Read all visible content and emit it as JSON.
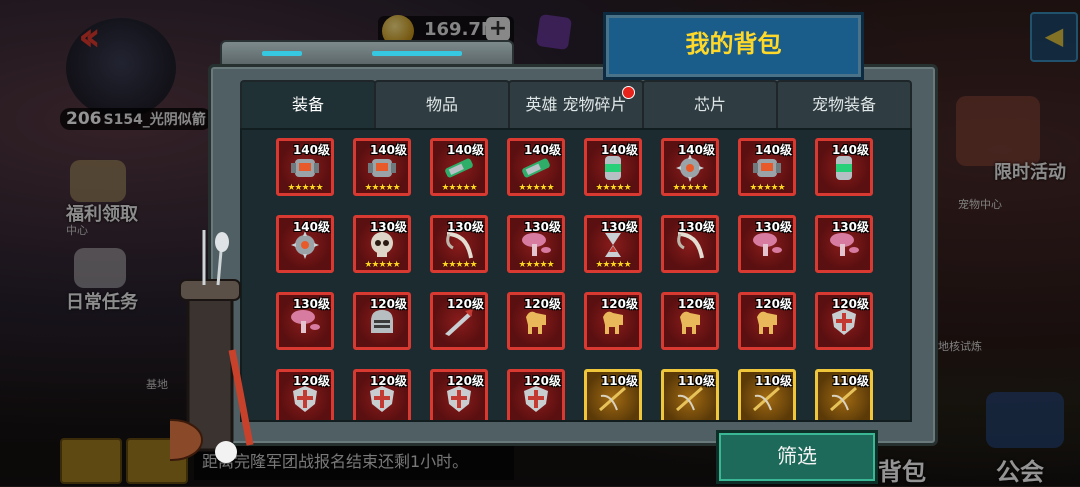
{
  "top_bar": {
    "player_level": "206",
    "player_name": "S154_光阴似箭",
    "currency": "169.7M",
    "currency_add": "+"
  },
  "side_left": {
    "welfare": "福利领取",
    "center": "中心",
    "daily": "日常任务",
    "base": "基地"
  },
  "side_right": {
    "limited_event": "限时活动",
    "pet_center": "宠物中心",
    "core_trial": "地核试炼"
  },
  "bottom": {
    "chat_text": "距离完隆军团战报名结束还剩1小时。",
    "bag": "背包",
    "guild": "公会"
  },
  "panel": {
    "title": "我的背包",
    "tabs": [
      {
        "label": "装备",
        "active": true,
        "badge": false
      },
      {
        "label": "物品",
        "active": false,
        "badge": false
      },
      {
        "label": "英雄 宠物碎片",
        "active": false,
        "badge": true
      },
      {
        "label": "芯片",
        "active": false,
        "badge": false
      },
      {
        "label": "宠物装备",
        "active": false,
        "badge": false
      }
    ],
    "filter_label": "筛选",
    "stars_label": "★★★★★",
    "items": [
      {
        "level": "140级",
        "stars": 5,
        "frame": "red",
        "icon": "mech-armor-icon"
      },
      {
        "level": "140级",
        "stars": 5,
        "frame": "red",
        "icon": "mech-armor-icon"
      },
      {
        "level": "140级",
        "stars": 5,
        "frame": "red",
        "icon": "plasma-cannon-icon"
      },
      {
        "level": "140级",
        "stars": 5,
        "frame": "red",
        "icon": "plasma-cannon-icon"
      },
      {
        "level": "140级",
        "stars": 5,
        "frame": "red",
        "icon": "energy-canister-icon"
      },
      {
        "level": "140级",
        "stars": 5,
        "frame": "red",
        "icon": "spiked-gear-icon"
      },
      {
        "level": "140级",
        "stars": 5,
        "frame": "red",
        "icon": "mech-armor-icon"
      },
      {
        "level": "140级",
        "stars": 0,
        "frame": "red",
        "icon": "energy-canister-icon"
      },
      {
        "level": "140级",
        "stars": 0,
        "frame": "red",
        "icon": "spiked-gear-icon"
      },
      {
        "level": "130级",
        "stars": 5,
        "frame": "red",
        "icon": "skull-helmet-icon"
      },
      {
        "level": "130级",
        "stars": 5,
        "frame": "red",
        "icon": "bone-scythe-icon"
      },
      {
        "level": "130级",
        "stars": 5,
        "frame": "red",
        "icon": "mushroom-icon"
      },
      {
        "level": "130级",
        "stars": 5,
        "frame": "red",
        "icon": "hourglass-icon"
      },
      {
        "level": "130级",
        "stars": 0,
        "frame": "red",
        "icon": "bone-scythe-icon"
      },
      {
        "level": "130级",
        "stars": 0,
        "frame": "red",
        "icon": "mushroom-icon"
      },
      {
        "level": "130级",
        "stars": 0,
        "frame": "red",
        "icon": "mushroom-icon"
      },
      {
        "level": "130级",
        "stars": 0,
        "frame": "red",
        "icon": "mushroom-icon"
      },
      {
        "level": "120级",
        "stars": 0,
        "frame": "red",
        "icon": "knight-helmet-icon"
      },
      {
        "level": "120级",
        "stars": 0,
        "frame": "red",
        "icon": "drill-lance-icon"
      },
      {
        "level": "120级",
        "stars": 0,
        "frame": "red",
        "icon": "wooden-horse-icon"
      },
      {
        "level": "120级",
        "stars": 0,
        "frame": "red",
        "icon": "wooden-horse-icon"
      },
      {
        "level": "120级",
        "stars": 0,
        "frame": "red",
        "icon": "wooden-horse-icon"
      },
      {
        "level": "120级",
        "stars": 0,
        "frame": "red",
        "icon": "wooden-horse-icon"
      },
      {
        "level": "120级",
        "stars": 0,
        "frame": "red",
        "icon": "cross-shield-icon"
      },
      {
        "level": "120级",
        "stars": 0,
        "frame": "red",
        "icon": "cross-shield-icon"
      },
      {
        "level": "120级",
        "stars": 0,
        "frame": "red",
        "icon": "cross-shield-icon"
      },
      {
        "level": "120级",
        "stars": 0,
        "frame": "red",
        "icon": "cross-shield-icon"
      },
      {
        "level": "120级",
        "stars": 0,
        "frame": "red",
        "icon": "cross-shield-icon"
      },
      {
        "level": "110级",
        "stars": 0,
        "frame": "gold",
        "icon": "crossbow-icon"
      },
      {
        "level": "110级",
        "stars": 0,
        "frame": "gold",
        "icon": "crossbow-icon"
      },
      {
        "level": "110级",
        "stars": 0,
        "frame": "gold",
        "icon": "crossbow-icon"
      },
      {
        "level": "110级",
        "stars": 0,
        "frame": "gold",
        "icon": "crossbow-icon"
      }
    ]
  },
  "colors": {
    "title_text": "#ffd92a",
    "frame_red": "#d83a32",
    "frame_gold": "#f0c63a",
    "filter_button": "#1d6a5a"
  }
}
